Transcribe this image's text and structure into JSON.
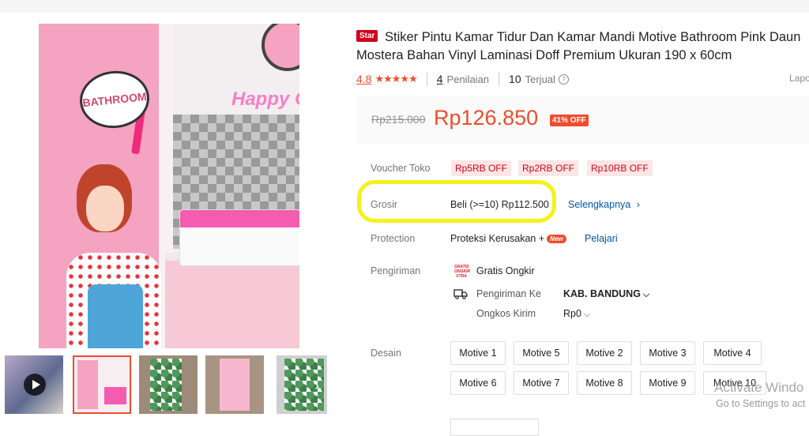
{
  "product": {
    "badge": "Star",
    "title": "Stiker Pintu Kamar Tidur Dan Kamar Mandi Motive Bathroom Pink Daun Mostera Bahan Vinyl Laminasi Doff Premium Ukuran 190 x 60cm",
    "rating": "4.8",
    "stars": "★★★★★",
    "reviews_count": "4",
    "reviews_label": "Penilaian",
    "sold_count": "10",
    "sold_label": "Terjual",
    "help_icon": "?",
    "report_label": "Lapo"
  },
  "gallery": {
    "bubble_text": "BATHROOM",
    "wall_text": "Happy Co",
    "next_arrow": "›"
  },
  "price": {
    "original": "Rp215.000",
    "current": "Rp126.850",
    "discount": "41% OFF"
  },
  "voucher": {
    "label": "Voucher Toko",
    "items": [
      "Rp5RB OFF",
      "Rp2RB OFF",
      "Rp10RB OFF"
    ]
  },
  "grosir": {
    "label": "Grosir",
    "value": "Beli (>=10) Rp112.500",
    "link": "Selengkapnya",
    "link_icon": "›"
  },
  "protection": {
    "label": "Protection",
    "value": "Proteksi Kerusakan +",
    "badge": "New",
    "link": "Pelajari"
  },
  "shipping": {
    "label": "Pengiriman",
    "gratis_logo": "GRATIS ONGKIR XTRA",
    "free": "Gratis Ongkir",
    "to_label": "Pengiriman Ke",
    "to_value": "KAB. BANDUNG",
    "cost_label": "Ongkos Kirim",
    "cost_value": "Rp0",
    "chevron": "⌵"
  },
  "design": {
    "label": "Desain",
    "options": [
      "Motive 1",
      "Motive 5",
      "Motive 2",
      "Motive 3",
      "Motive 4",
      "Motive 6",
      "Motive 7",
      "Motive 8",
      "Motive 9",
      "Motive 10"
    ]
  },
  "watermark": {
    "title": "Activate Windo",
    "subtitle": "Go to Settings to act"
  },
  "colors": {
    "accent": "#ee4d2d",
    "highlight": "#f3f21b",
    "link": "#0055aa"
  }
}
